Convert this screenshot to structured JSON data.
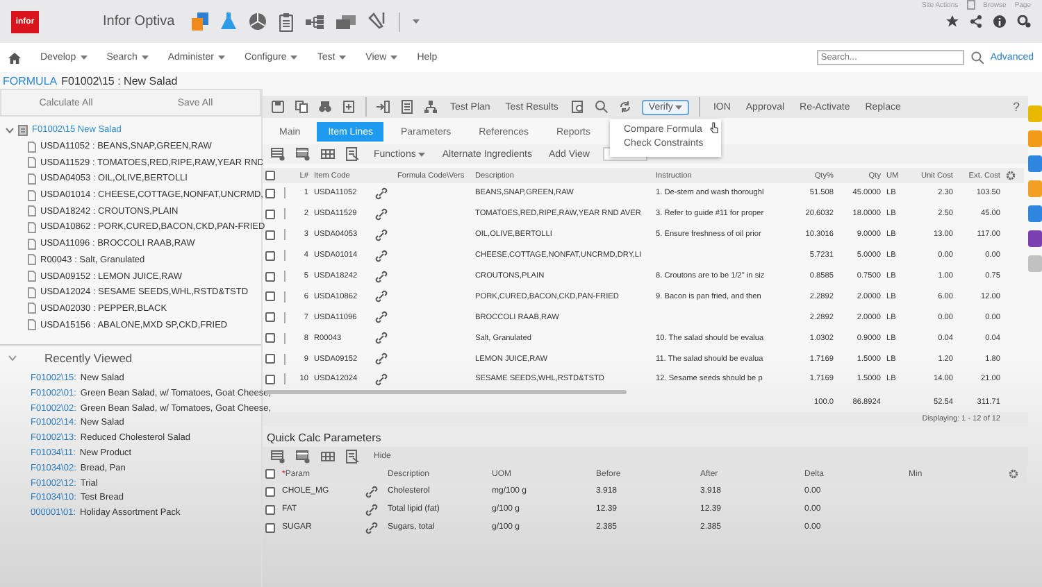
{
  "header": {
    "logo": "infor",
    "app_title": "Infor Optiva",
    "site_actions": "Site Actions",
    "browse": "Browse",
    "page": "Page"
  },
  "nav": {
    "items": [
      {
        "label": "Develop",
        "dropdown": true
      },
      {
        "label": "Search",
        "dropdown": true
      },
      {
        "label": "Administer",
        "dropdown": true
      },
      {
        "label": "Configure",
        "dropdown": true
      },
      {
        "label": "Test",
        "dropdown": true
      },
      {
        "label": "View",
        "dropdown": true
      },
      {
        "label": "Help",
        "dropdown": false
      }
    ],
    "search": {
      "placeholder": "Search..."
    },
    "advanced": "Advanced"
  },
  "title": {
    "kind_label": "FORMULA",
    "name": "F01002\\15 : New Salad"
  },
  "left": {
    "buttons": [
      "Calculate All",
      "Save All"
    ],
    "tree": [
      {
        "label": "F01002\\15  New Salad",
        "expanded": true,
        "children": [
          {
            "label": "USDA11052 : BEANS,SNAP,GREEN,RAW"
          },
          {
            "label": "USDA11529 : TOMATOES,RED,RIPE,RAW,YEAR RND"
          },
          {
            "label": "USDA04053 : OIL,OLIVE,BERTOLLI"
          },
          {
            "label": "USDA01014 : CHEESE,COTTAGE,NONFAT,UNCRMD,"
          },
          {
            "label": "USDA18242 : CROUTONS,PLAIN"
          },
          {
            "label": "USDA10862 : PORK,CURED,BACON,CKD,PAN-FRIED"
          },
          {
            "label": "USDA11096 : BROCCOLI RAAB,RAW"
          },
          {
            "label": "R00043 : Salt, Granulated"
          },
          {
            "label": "USDA09152 : LEMON JUICE,RAW"
          },
          {
            "label": "USDA12024 : SESAME SEEDS,WHL,RSTD&TSTD"
          },
          {
            "label": "USDA02030 : PEPPER,BLACK"
          },
          {
            "label": "USDA15156 : ABALONE,MXD SP,CKD,FRIED"
          }
        ]
      }
    ],
    "recent": {
      "title": "Recently Viewed",
      "expanded": true,
      "items": [
        {
          "code": "F01002\\15:",
          "name": "New Salad"
        },
        {
          "code": "F01002\\01:",
          "name": "Green Bean Salad, w/ Tomatoes, Goat Cheese,"
        },
        {
          "code": "F01002\\02:",
          "name": "Green Bean Salad, w/ Tomatoes, Goat Cheese,"
        },
        {
          "code": "F01002\\14:",
          "name": "New Salad"
        },
        {
          "code": "F01002\\13:",
          "name": "Reduced Cholesterol Salad"
        },
        {
          "code": "F01034\\11:",
          "name": "New Product"
        },
        {
          "code": "F01034\\02:",
          "name": "Bread, Pan"
        },
        {
          "code": "F01002\\12:",
          "name": "Trial"
        },
        {
          "code": "F01034\\10:",
          "name": "Test Bread"
        },
        {
          "code": "000001\\01:",
          "name": "Holiday Assortment Pack"
        }
      ]
    }
  },
  "toolbar": {
    "text_buttons": [
      "Test Plan",
      "Test Results"
    ],
    "verify": "Verify",
    "actions": [
      "ION",
      "Approval",
      "Re-Activate",
      "Replace"
    ],
    "help": "?"
  },
  "verify_menu": {
    "items": [
      "Compare Formula",
      "Check Constraints"
    ]
  },
  "tabs": [
    {
      "label": "Main",
      "selected": false
    },
    {
      "label": "Item Lines",
      "selected": true
    },
    {
      "label": "Parameters",
      "selected": false
    },
    {
      "label": "References",
      "selected": false
    },
    {
      "label": "Reports",
      "selected": false
    }
  ],
  "subtoolbar": {
    "functions": "Functions",
    "alternate": "Alternate Ingredients",
    "add_view": "Add View"
  },
  "item_table": {
    "all_checked": false,
    "columns": [
      "L#",
      "Item Code",
      "Formula Code\\Vers",
      "Description",
      "Instruction",
      "Qty%",
      "Qty",
      "UM",
      "Unit Cost",
      "Ext. Cost"
    ],
    "rows": [
      {
        "checked": false,
        "line": "1",
        "code": "USDA11052",
        "description": "BEANS,SNAP,GREEN,RAW",
        "instruction": "1. De-stem and wash thoroughl",
        "qty_pct": "51.508",
        "qty": "45.0000",
        "um": "LB",
        "unit_cost": "2.30",
        "ext_cost": "103.50"
      },
      {
        "checked": false,
        "line": "2",
        "code": "USDA11529",
        "description": "TOMATOES,RED,RIPE,RAW,YEAR RND AVER",
        "instruction": "3. Refer to guide #11 for proper",
        "qty_pct": "20.6032",
        "qty": "18.0000",
        "um": "LB",
        "unit_cost": "2.50",
        "ext_cost": "45.00"
      },
      {
        "checked": false,
        "line": "3",
        "code": "USDA04053",
        "description": "OIL,OLIVE,BERTOLLI",
        "instruction": "5. Ensure freshness of oil prior",
        "qty_pct": "10.3016",
        "qty": "9.0000",
        "um": "LB",
        "unit_cost": "13.00",
        "ext_cost": "117.00"
      },
      {
        "checked": false,
        "line": "4",
        "code": "USDA01014",
        "description": "CHEESE,COTTAGE,NONFAT,UNCRMD,DRY,LI",
        "qty_pct": "5.7231",
        "qty": "5.0000",
        "um": "LB",
        "unit_cost": "0.00",
        "ext_cost": "0.00"
      },
      {
        "checked": false,
        "line": "5",
        "code": "USDA18242",
        "description": "CROUTONS,PLAIN",
        "instruction": "8. Croutons are to be 1/2\" in siz",
        "qty_pct": "0.8585",
        "qty": "0.7500",
        "um": "LB",
        "unit_cost": "1.00",
        "ext_cost": "0.75"
      },
      {
        "checked": false,
        "line": "6",
        "code": "USDA10862",
        "description": "PORK,CURED,BACON,CKD,PAN-FRIED",
        "instruction": "9. Bacon is pan fried, and then",
        "qty_pct": "2.2892",
        "qty": "2.0000",
        "um": "LB",
        "unit_cost": "6.00",
        "ext_cost": "12.00"
      },
      {
        "checked": false,
        "line": "7",
        "code": "USDA11096",
        "description": "BROCCOLI RAAB,RAW",
        "qty_pct": "2.2892",
        "qty": "2.0000",
        "um": "LB",
        "unit_cost": "0.00",
        "ext_cost": "0.00"
      },
      {
        "checked": false,
        "line": "8",
        "code": "R00043",
        "description": "Salt, Granulated",
        "instruction": "10. The salad should be evalua",
        "qty_pct": "1.0302",
        "qty": "0.9000",
        "um": "LB",
        "unit_cost": "0.04",
        "ext_cost": "0.04"
      },
      {
        "checked": false,
        "line": "9",
        "code": "USDA09152",
        "description": "LEMON JUICE,RAW",
        "instruction": "11. The salad should be evalua",
        "qty_pct": "1.7169",
        "qty": "1.5000",
        "um": "LB",
        "unit_cost": "1.20",
        "ext_cost": "1.80"
      },
      {
        "checked": false,
        "line": "10",
        "code": "USDA12024",
        "description": "SESAME SEEDS,WHL,RSTD&TSTD",
        "instruction": "12. Sesame seeds should be p",
        "qty_pct": "1.7169",
        "qty": "1.5000",
        "um": "LB",
        "unit_cost": "14.00",
        "ext_cost": "21.00"
      }
    ],
    "totals": {
      "qty_pct": "100.0",
      "qty": "86.8924",
      "unit_cost": "52.54",
      "ext_cost": "311.71"
    },
    "footer": "Displaying: 1 - 12 of 12"
  },
  "quick_calc": {
    "all_checked": false,
    "title": "Quick Calc Parameters",
    "hide": "Hide",
    "required_mark": "*",
    "columns": [
      "Param",
      "Description",
      "UOM",
      "Before",
      "After",
      "Delta",
      "Min"
    ],
    "rows": [
      {
        "checked": false,
        "param": "CHOLE_MG",
        "description": "Cholesterol",
        "uom": "mg/100 g",
        "before": "3.918",
        "after": "3.918",
        "delta": "0.00"
      },
      {
        "checked": false,
        "param": "FAT",
        "description": "Total lipid (fat)",
        "uom": "g/100 g",
        "before": "12.39",
        "after": "12.39",
        "delta": "0.00"
      },
      {
        "checked": false,
        "param": "SUGAR",
        "description": "Sugars, total",
        "uom": "g/100 g",
        "before": "2.385",
        "after": "2.385",
        "delta": "0.00"
      }
    ]
  }
}
